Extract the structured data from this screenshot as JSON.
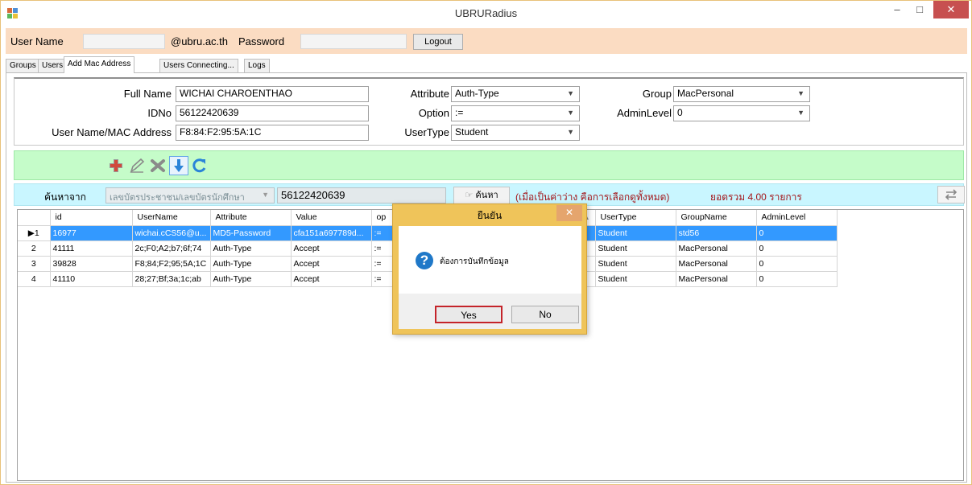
{
  "window": {
    "title": "UBRURadius",
    "minimize": "–",
    "maximize": "□",
    "close": "✕"
  },
  "login": {
    "username_label": "User Name",
    "username_value": "",
    "domain": "@ubru.ac.th",
    "password_label": "Password",
    "password_value": "",
    "logout_label": "Logout"
  },
  "tabs": [
    "Groups",
    "Users",
    "Add Mac Address",
    "Users Connecting...",
    "Logs"
  ],
  "form": {
    "fullname_label": "Full Name",
    "fullname_value": "WICHAI   CHAROENTHAO",
    "idno_label": "IDNo",
    "idno_value": "56122420639",
    "mac_label": "User Name/MAC Address",
    "mac_value": "F8:84:F2:95:5A:1C",
    "attribute_label": "Attribute",
    "attribute_value": "Auth-Type",
    "option_label": "Option",
    "option_value": ":=",
    "usertype_label": "UserType",
    "usertype_value": "Student",
    "group_label": "Group",
    "group_value": "MacPersonal",
    "adminlevel_label": "AdminLevel",
    "adminlevel_value": "0"
  },
  "toolbar": {
    "add_icon": "add-icon",
    "edit_icon": "edit-icon",
    "delete_icon": "delete-icon",
    "save_icon": "save-down-arrow-icon",
    "refresh_icon": "refresh-icon"
  },
  "search": {
    "label": "ค้นหาจาก",
    "field_combo": "เลขบัตรประชาชน/เลขบัตรนักศึกษา",
    "value": "56122420639",
    "button": "ค้นหา",
    "hint": "(เมื่อเป็นค่าว่าง คือการเลือกดูทั้งหมด)",
    "total": "ยอดรวม 4.00 รายการ"
  },
  "grid": {
    "columns": [
      "id",
      "UserName",
      "Attribute",
      "Value",
      "op",
      "UserType",
      "GroupName",
      "AdminLevel"
    ],
    "rows": [
      {
        "num": "1",
        "id": "16977",
        "username": "wichai.cCS56@u...",
        "attribute": "MD5-Password",
        "value": "cfa151a697789d...",
        "op": ":=",
        "usertype": "Student",
        "group": "std56",
        "admin": "0"
      },
      {
        "num": "2",
        "id": "41111",
        "username": "2c;F0;A2;b7;6f;74",
        "attribute": "Auth-Type",
        "value": "Accept",
        "op": ":=",
        "usertype": "Student",
        "group": "MacPersonal",
        "admin": "0"
      },
      {
        "num": "3",
        "id": "39828",
        "username": "F8;84;F2;95;5A;1C",
        "attribute": "Auth-Type",
        "value": "Accept",
        "op": ":=",
        "usertype": "Student",
        "group": "MacPersonal",
        "admin": "0"
      },
      {
        "num": "4",
        "id": "41110",
        "username": "28;27;Bf;3a;1c;ab",
        "attribute": "Auth-Type",
        "value": "Accept",
        "op": ":=",
        "usertype": "Student",
        "group": "MacPersonal",
        "admin": "0"
      }
    ]
  },
  "dialog": {
    "title": "ยืนยัน",
    "message": "ต้องการบันทึกข้อมูล",
    "yes": "Yes",
    "no": "No",
    "close": "✕",
    "icon": "?"
  },
  "colors": {
    "login_bar": "#fbdcc2",
    "toolbar": "#c5fcc9",
    "searchbar": "#c9f6ff",
    "selection": "#3399ff",
    "dialog_frame": "#efc45a",
    "hint_text": "#a3161a"
  }
}
